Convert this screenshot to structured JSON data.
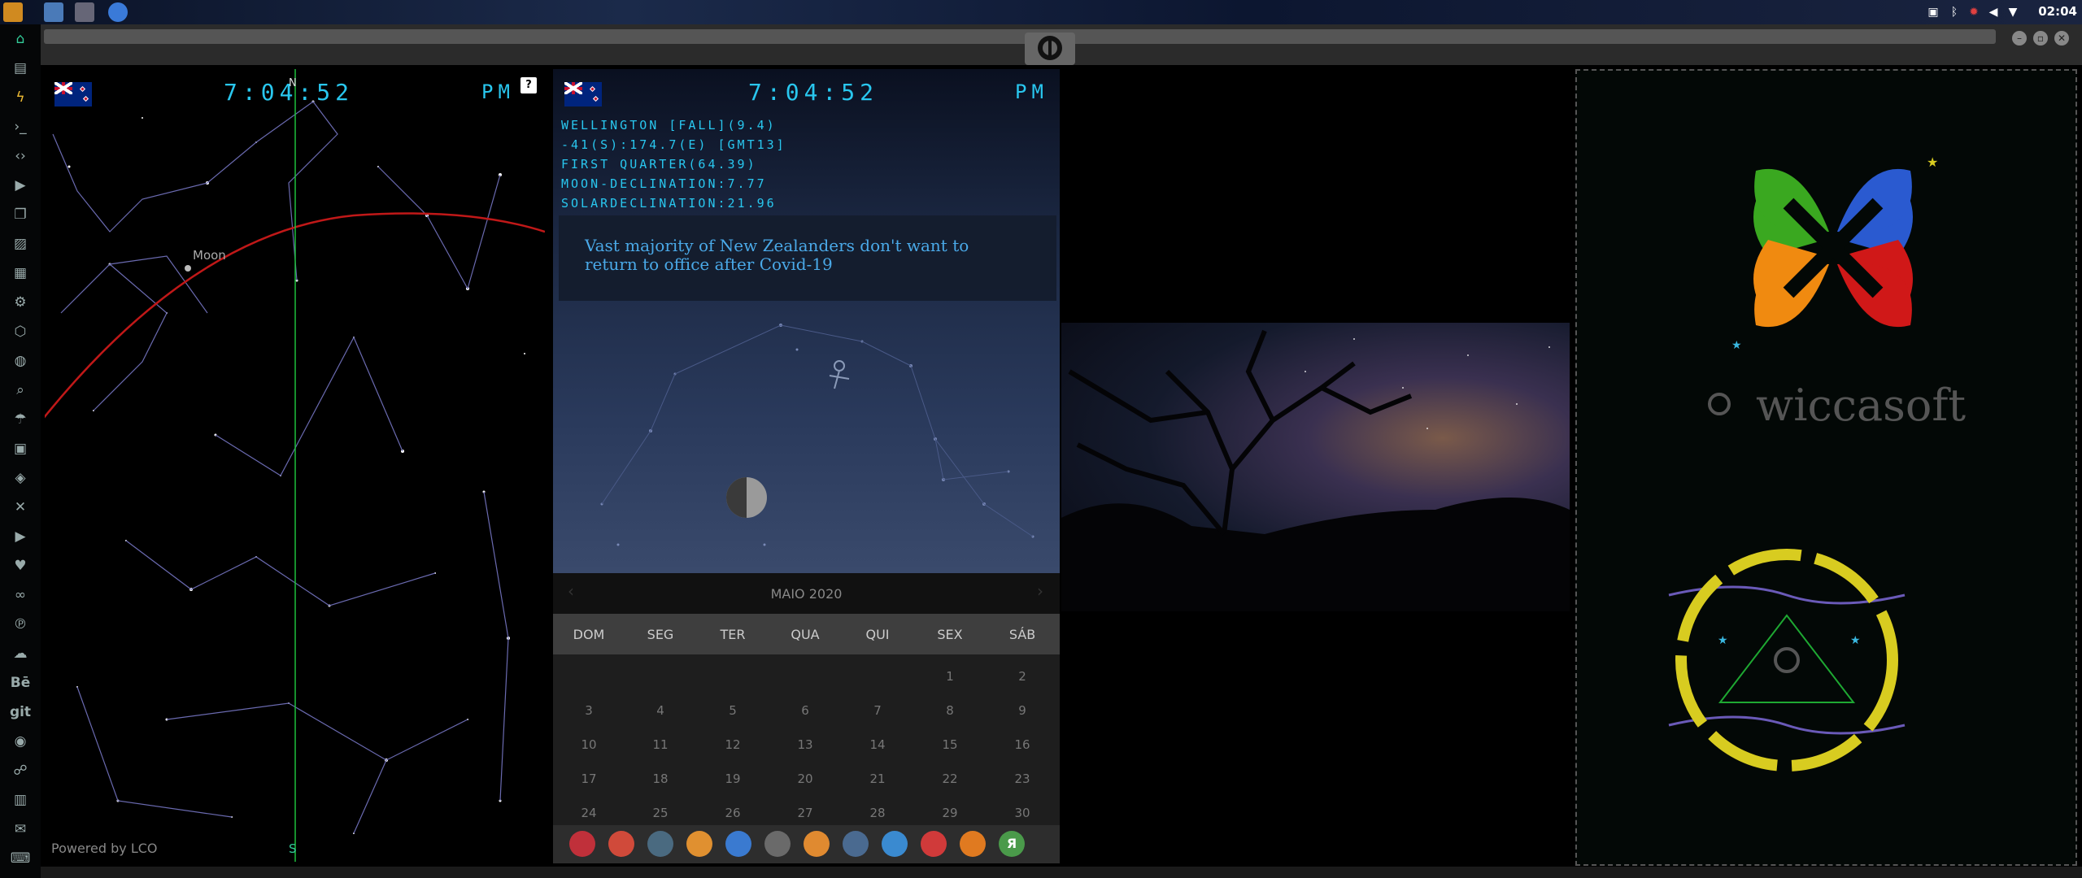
{
  "topbar": {
    "clock": "02:04",
    "icons": [
      "app-menu-icon",
      "files-icon",
      "window-icon",
      "chrome-icon"
    ],
    "tray_icons": [
      "screenshot-icon",
      "bluetooth-icon",
      "gear-icon",
      "volume-icon",
      "wifi-icon"
    ],
    "accent": "#f0a020"
  },
  "dock": {
    "items": [
      "home-icon",
      "document-icon",
      "flash-icon",
      "terminal-icon",
      "code-icon",
      "play-icon",
      "copy-icon",
      "image-icon",
      "newspaper-icon",
      "settings-icon",
      "hexagon-icon",
      "globe-icon",
      "search-icon",
      "umbrella-icon",
      "contact-icon",
      "git-diff-icon",
      "expand-icon",
      "youtube-icon",
      "heart-icon",
      "infinity-icon",
      "pinterest-icon",
      "cloud-icon",
      "behance-icon",
      "git-icon",
      "github-icon",
      "network-icon",
      "map-icon",
      "mail-icon",
      "keyboard-icon"
    ],
    "behance_label": "Bē",
    "git_label": "git"
  },
  "skymap": {
    "time": "7:04:52",
    "ampm": "PM",
    "north_label": "N",
    "south_label": "S",
    "moon_label": "Moon",
    "help_label": "?",
    "credit": "Powered by LCO"
  },
  "astro": {
    "time": "7:04:52",
    "ampm": "PM",
    "lines": [
      "WELLINGTON [FALL](9.4)",
      "-41(S):174.7(E) [GMT13]",
      "FIRST QUARTER(64.39)",
      "MOON-DECLINATION:7.77",
      "SOLARDECLINATION:21.96"
    ],
    "news": "Vast majority of New Zealanders don't want to return to office after Covid-19"
  },
  "calendar": {
    "month": "MAIO 2020",
    "prev": "‹",
    "next": "›",
    "weekdays": [
      "DOM",
      "SEG",
      "TER",
      "QUA",
      "QUI",
      "SEX",
      "SÁB"
    ],
    "weeks": [
      [
        "",
        "",
        "",
        "",
        "",
        "1",
        "2"
      ],
      [
        "3",
        "4",
        "5",
        "6",
        "7",
        "8",
        "9"
      ],
      [
        "10",
        "11",
        "12",
        "13",
        "14",
        "15",
        "16"
      ],
      [
        "17",
        "18",
        "19",
        "20",
        "21",
        "22",
        "23"
      ],
      [
        "24",
        "25",
        "26",
        "27",
        "28",
        "29",
        "30"
      ]
    ]
  },
  "taskbar": {
    "items": [
      "arch-icon",
      "hourglass-icon",
      "earth-icon",
      "photo-app-icon",
      "translate-icon",
      "calendar-app-icon",
      "magnifier-icon",
      "clock-app-icon",
      "world-icon",
      "calendar-today-icon",
      "play-arrow-icon",
      "yandex-icon"
    ],
    "colors": [
      "#c0303a",
      "#d04a3a",
      "#4a6a80",
      "#e09030",
      "#3a7ad0",
      "#6a6a6a",
      "#e08a30",
      "#4a6a90",
      "#3a8ad0",
      "#d03a3a",
      "#e07a20",
      "#4a9a4a"
    ],
    "yandex_label": "Я"
  },
  "logo": {
    "brand": "wiccasoft",
    "colors": {
      "green": "#3aa820",
      "blue": "#2a5ad0",
      "orange": "#f08a10",
      "red": "#d01818",
      "yellow": "#d8cc20",
      "purple": "#6a5ab8"
    }
  },
  "window": {
    "buttons": [
      "minimize-button",
      "maximize-button",
      "close-button"
    ],
    "button_labels": [
      "–",
      "▫",
      "✕"
    ]
  }
}
